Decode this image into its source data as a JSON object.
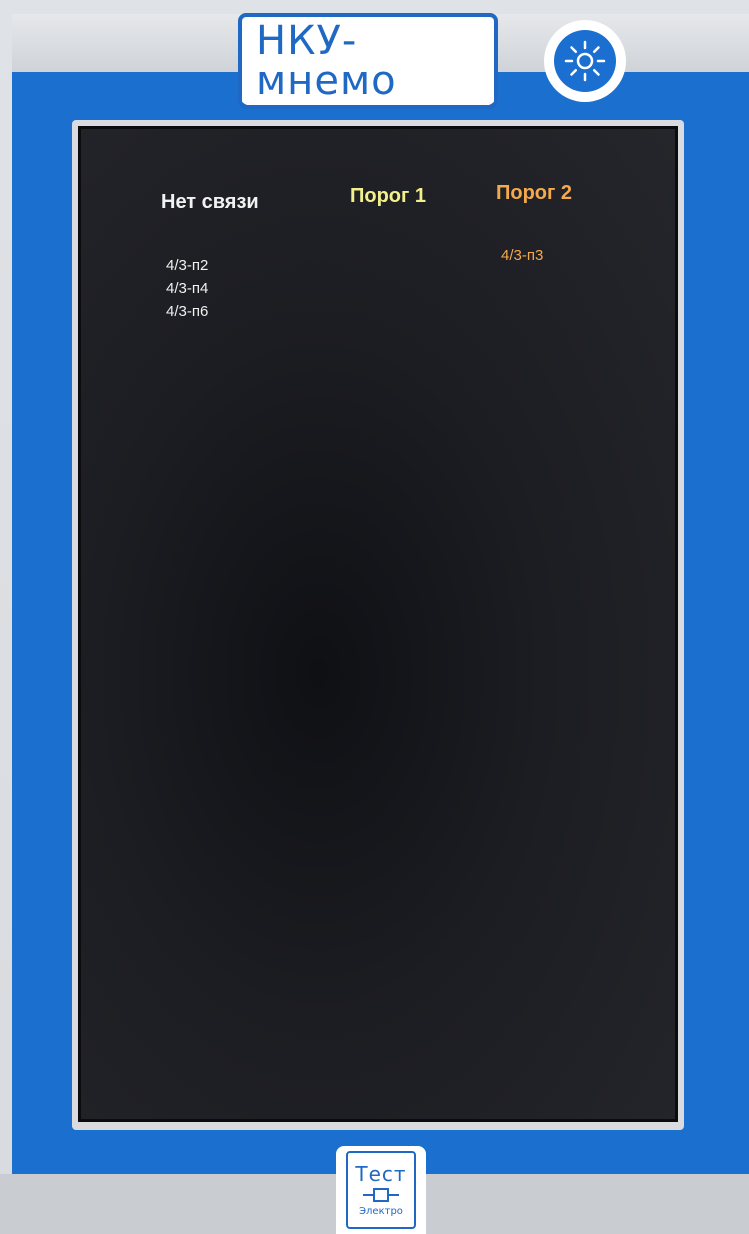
{
  "header": {
    "logo_text": "НКУ-мнемо",
    "brightness_icon": "sun-icon"
  },
  "screen": {
    "columns": [
      {
        "title": "Нет связи",
        "color": "#f2f2f2",
        "items": [
          "4/3-п2",
          "4/3-п4",
          "4/3-п6"
        ]
      },
      {
        "title": "Порог 1",
        "color": "#f3f08a",
        "items": []
      },
      {
        "title": "Порог 2",
        "color": "#f5a94e",
        "items": [
          "4/3-п3"
        ]
      }
    ]
  },
  "footer": {
    "brand_top": "Тест",
    "brand_bottom": "Электро",
    "brand_symbol_icon": "resistor-symbol-icon"
  },
  "colors": {
    "panel_blue": "#1b6fcf",
    "screen_bg": "#1c1d22",
    "logo_blue": "#1f69c4"
  }
}
